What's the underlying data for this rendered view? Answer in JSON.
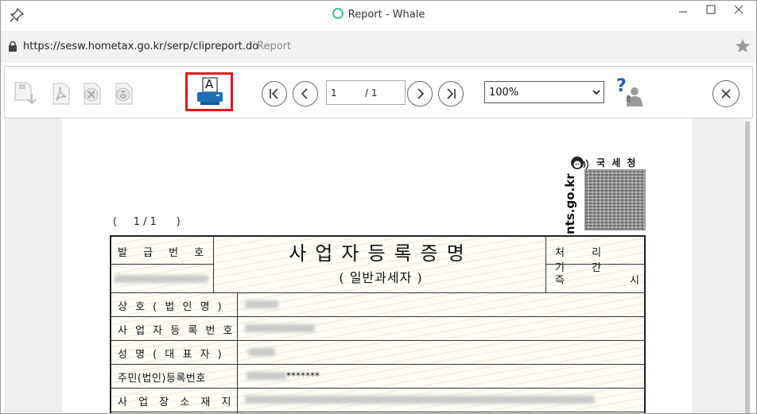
{
  "window": {
    "title": "Report - Whale",
    "minimize_icon": "minimize-icon",
    "maximize_icon": "maximize-icon",
    "close_icon": "close-icon"
  },
  "address_bar": {
    "url": "https://sesw.hometax.go.kr/serp/clipreport.do",
    "page_title": "Report"
  },
  "toolbar": {
    "current_page": "1",
    "total_pages": "/ 1",
    "zoom": "100%",
    "print_label": "A",
    "help_mark": "?"
  },
  "document": {
    "page_indicator": "(     1 / 1      )",
    "agency_name": "국 세 청",
    "agency_url": "nts.go.kr",
    "title": "사업자등록증명",
    "subtitle": "( 일반과세자 )",
    "labels": {
      "issue_number": "발 급 번 호",
      "processing_period": "처 리 기 간",
      "immediate": "즉",
      "time": "시",
      "company_name": "상 호 ( 법 인 명 )",
      "business_reg_number": "사 업 자 등 록 번 호",
      "representative": "성 명 ( 대 표 자 )",
      "resident_reg_number": "주민(법인)등록번호",
      "business_location": "사 업 장 소 재 지"
    },
    "masked_suffix": "*******"
  },
  "colors": {
    "highlight": "#e0161e",
    "print_icon_blue": "#1e6fb5",
    "whale_logo": "#3ebfa3"
  }
}
